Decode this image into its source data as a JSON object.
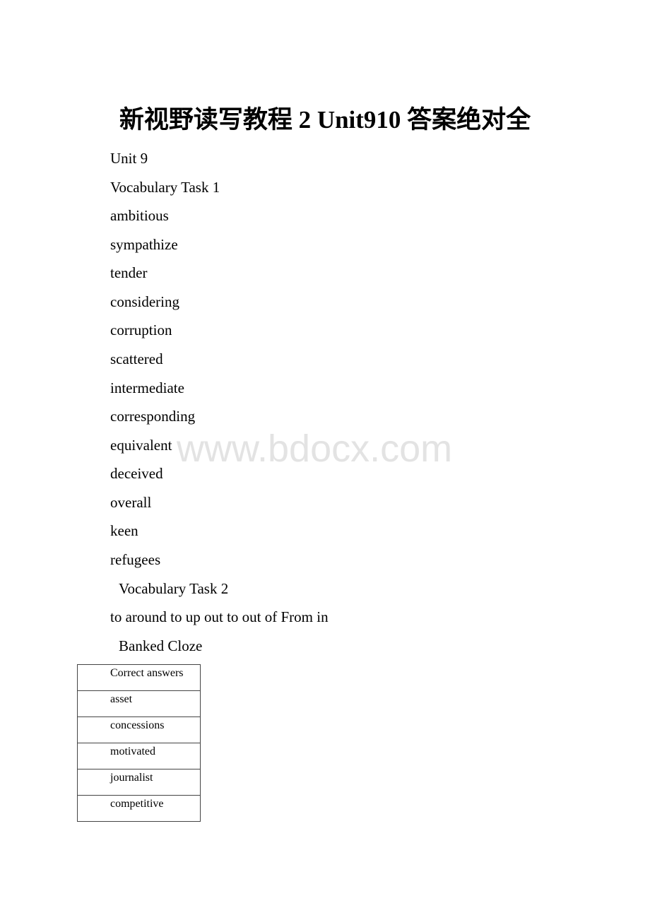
{
  "document": {
    "title": "新视野读写教程 2 Unit910 答案绝对全",
    "unit_heading": "Unit 9",
    "vocab_task1": {
      "heading": "Vocabulary Task 1",
      "answers": [
        "ambitious",
        "sympathize",
        "tender",
        "considering",
        "corruption",
        "scattered",
        "intermediate",
        "corresponding",
        "equivalent",
        "deceived",
        "overall",
        "keen",
        "refugees"
      ]
    },
    "vocab_task2": {
      "heading": "Vocabulary Task 2",
      "answers_line": "to around to up out to out of From in"
    },
    "banked_cloze": {
      "heading": "Banked Cloze",
      "table": {
        "header": "Correct answers",
        "rows": [
          "asset",
          "concessions",
          "motivated",
          "journalist",
          "competitive"
        ]
      }
    },
    "watermark": "www.bdocx.com"
  }
}
